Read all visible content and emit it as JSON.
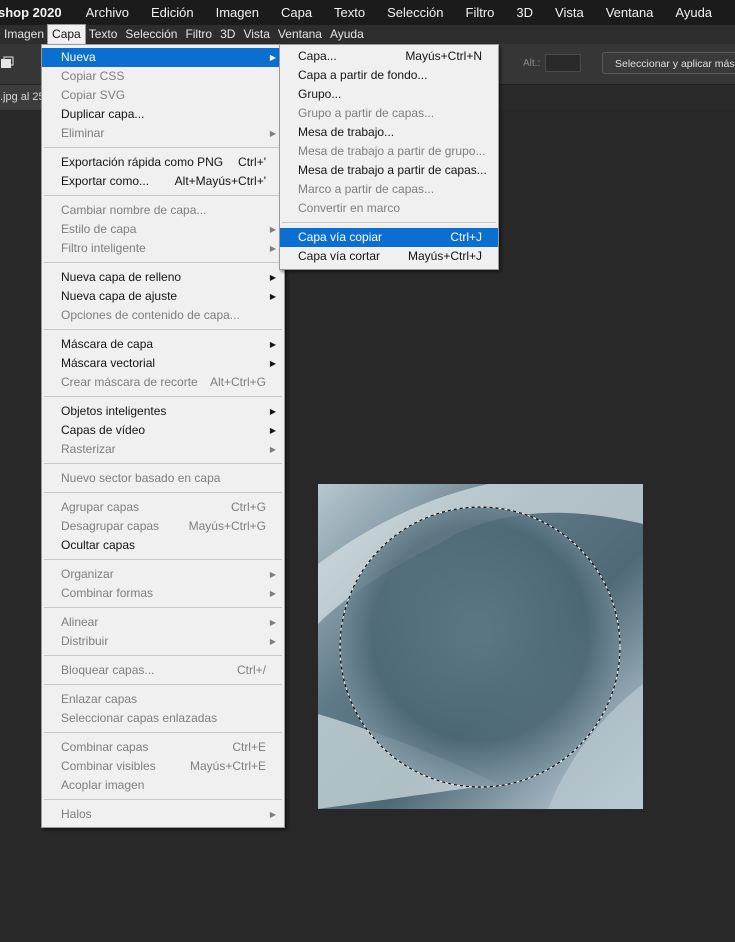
{
  "appbar": {
    "app_name": "shop 2020",
    "menus": [
      "Archivo",
      "Edición",
      "Imagen",
      "Capa",
      "Texto",
      "Selección",
      "Filtro",
      "3D",
      "Vista",
      "Ventana",
      "Ayuda"
    ]
  },
  "ps_menubar": {
    "items": [
      "Imagen",
      "Capa",
      "Texto",
      "Selección",
      "Filtro",
      "3D",
      "Vista",
      "Ventana",
      "Ayuda"
    ],
    "active_index": 1
  },
  "options_bar": {
    "alt_label": "Alt.:",
    "mask_button_label": "Seleccionar y aplicar máscara..."
  },
  "document_tab": {
    "title": ".jpg al 25"
  },
  "layer_menu": {
    "items": [
      {
        "label": "Nueva",
        "shortcut": "",
        "submenu": true,
        "disabled": false,
        "highlight": true
      },
      {
        "label": "Copiar CSS",
        "shortcut": "",
        "submenu": false,
        "disabled": true
      },
      {
        "label": "Copiar SVG",
        "shortcut": "",
        "submenu": false,
        "disabled": true
      },
      {
        "label": "Duplicar capa...",
        "shortcut": "",
        "submenu": false,
        "disabled": false
      },
      {
        "label": "Eliminar",
        "shortcut": "",
        "submenu": true,
        "disabled": true
      },
      {
        "sep": true
      },
      {
        "label": "Exportación rápida como PNG",
        "shortcut": "Ctrl+'",
        "submenu": false,
        "disabled": false
      },
      {
        "label": "Exportar como...",
        "shortcut": "Alt+Mayús+Ctrl+'",
        "submenu": false,
        "disabled": false
      },
      {
        "sep": true
      },
      {
        "label": "Cambiar nombre de capa...",
        "shortcut": "",
        "submenu": false,
        "disabled": true
      },
      {
        "label": "Estilo de capa",
        "shortcut": "",
        "submenu": true,
        "disabled": true
      },
      {
        "label": "Filtro inteligente",
        "shortcut": "",
        "submenu": true,
        "disabled": true
      },
      {
        "sep": true
      },
      {
        "label": "Nueva capa de relleno",
        "shortcut": "",
        "submenu": true,
        "disabled": false
      },
      {
        "label": "Nueva capa de ajuste",
        "shortcut": "",
        "submenu": true,
        "disabled": false
      },
      {
        "label": "Opciones de contenido de capa...",
        "shortcut": "",
        "submenu": false,
        "disabled": true
      },
      {
        "sep": true
      },
      {
        "label": "Máscara de capa",
        "shortcut": "",
        "submenu": true,
        "disabled": false
      },
      {
        "label": "Máscara vectorial",
        "shortcut": "",
        "submenu": true,
        "disabled": false
      },
      {
        "label": "Crear máscara de recorte",
        "shortcut": "Alt+Ctrl+G",
        "submenu": false,
        "disabled": true
      },
      {
        "sep": true
      },
      {
        "label": "Objetos inteligentes",
        "shortcut": "",
        "submenu": true,
        "disabled": false
      },
      {
        "label": "Capas de vídeo",
        "shortcut": "",
        "submenu": true,
        "disabled": false
      },
      {
        "label": "Rasterizar",
        "shortcut": "",
        "submenu": true,
        "disabled": true
      },
      {
        "sep": true
      },
      {
        "label": "Nuevo sector basado en capa",
        "shortcut": "",
        "submenu": false,
        "disabled": true
      },
      {
        "sep": true
      },
      {
        "label": "Agrupar capas",
        "shortcut": "Ctrl+G",
        "submenu": false,
        "disabled": true
      },
      {
        "label": "Desagrupar capas",
        "shortcut": "Mayús+Ctrl+G",
        "submenu": false,
        "disabled": true
      },
      {
        "label": "Ocultar capas",
        "shortcut": "",
        "submenu": false,
        "disabled": false
      },
      {
        "sep": true
      },
      {
        "label": "Organizar",
        "shortcut": "",
        "submenu": true,
        "disabled": true
      },
      {
        "label": "Combinar formas",
        "shortcut": "",
        "submenu": true,
        "disabled": true
      },
      {
        "sep": true
      },
      {
        "label": "Alinear",
        "shortcut": "",
        "submenu": true,
        "disabled": true
      },
      {
        "label": "Distribuir",
        "shortcut": "",
        "submenu": true,
        "disabled": true
      },
      {
        "sep": true
      },
      {
        "label": "Bloquear capas...",
        "shortcut": "Ctrl+/",
        "submenu": false,
        "disabled": true
      },
      {
        "sep": true
      },
      {
        "label": "Enlazar capas",
        "shortcut": "",
        "submenu": false,
        "disabled": true
      },
      {
        "label": "Seleccionar capas enlazadas",
        "shortcut": "",
        "submenu": false,
        "disabled": true
      },
      {
        "sep": true
      },
      {
        "label": "Combinar capas",
        "shortcut": "Ctrl+E",
        "submenu": false,
        "disabled": true
      },
      {
        "label": "Combinar visibles",
        "shortcut": "Mayús+Ctrl+E",
        "submenu": false,
        "disabled": true
      },
      {
        "label": "Acoplar imagen",
        "shortcut": "",
        "submenu": false,
        "disabled": true
      },
      {
        "sep": true
      },
      {
        "label": "Halos",
        "shortcut": "",
        "submenu": true,
        "disabled": true
      }
    ]
  },
  "new_submenu": {
    "items": [
      {
        "label": "Capa...",
        "shortcut": "Mayús+Ctrl+N",
        "disabled": false
      },
      {
        "label": "Capa a partir de fondo...",
        "shortcut": "",
        "disabled": false
      },
      {
        "label": "Grupo...",
        "shortcut": "",
        "disabled": false
      },
      {
        "label": "Grupo a partir de capas...",
        "shortcut": "",
        "disabled": true
      },
      {
        "label": "Mesa de trabajo...",
        "shortcut": "",
        "disabled": false
      },
      {
        "label": "Mesa de trabajo a partir de grupo...",
        "shortcut": "",
        "disabled": true
      },
      {
        "label": "Mesa de trabajo a partir de capas...",
        "shortcut": "",
        "disabled": false
      },
      {
        "label": "Marco a partir de capas...",
        "shortcut": "",
        "disabled": true
      },
      {
        "label": "Convertir en marco",
        "shortcut": "",
        "disabled": true
      },
      {
        "sep": true
      },
      {
        "label": "Capa vía copiar",
        "shortcut": "Ctrl+J",
        "disabled": false,
        "highlight": true
      },
      {
        "label": "Capa vía cortar",
        "shortcut": "Mayús+Ctrl+J",
        "disabled": false
      }
    ]
  },
  "colors": {
    "highlight": "#0a6fd1",
    "menu_bg": "#f0f0f0",
    "workspace": "#282828"
  }
}
